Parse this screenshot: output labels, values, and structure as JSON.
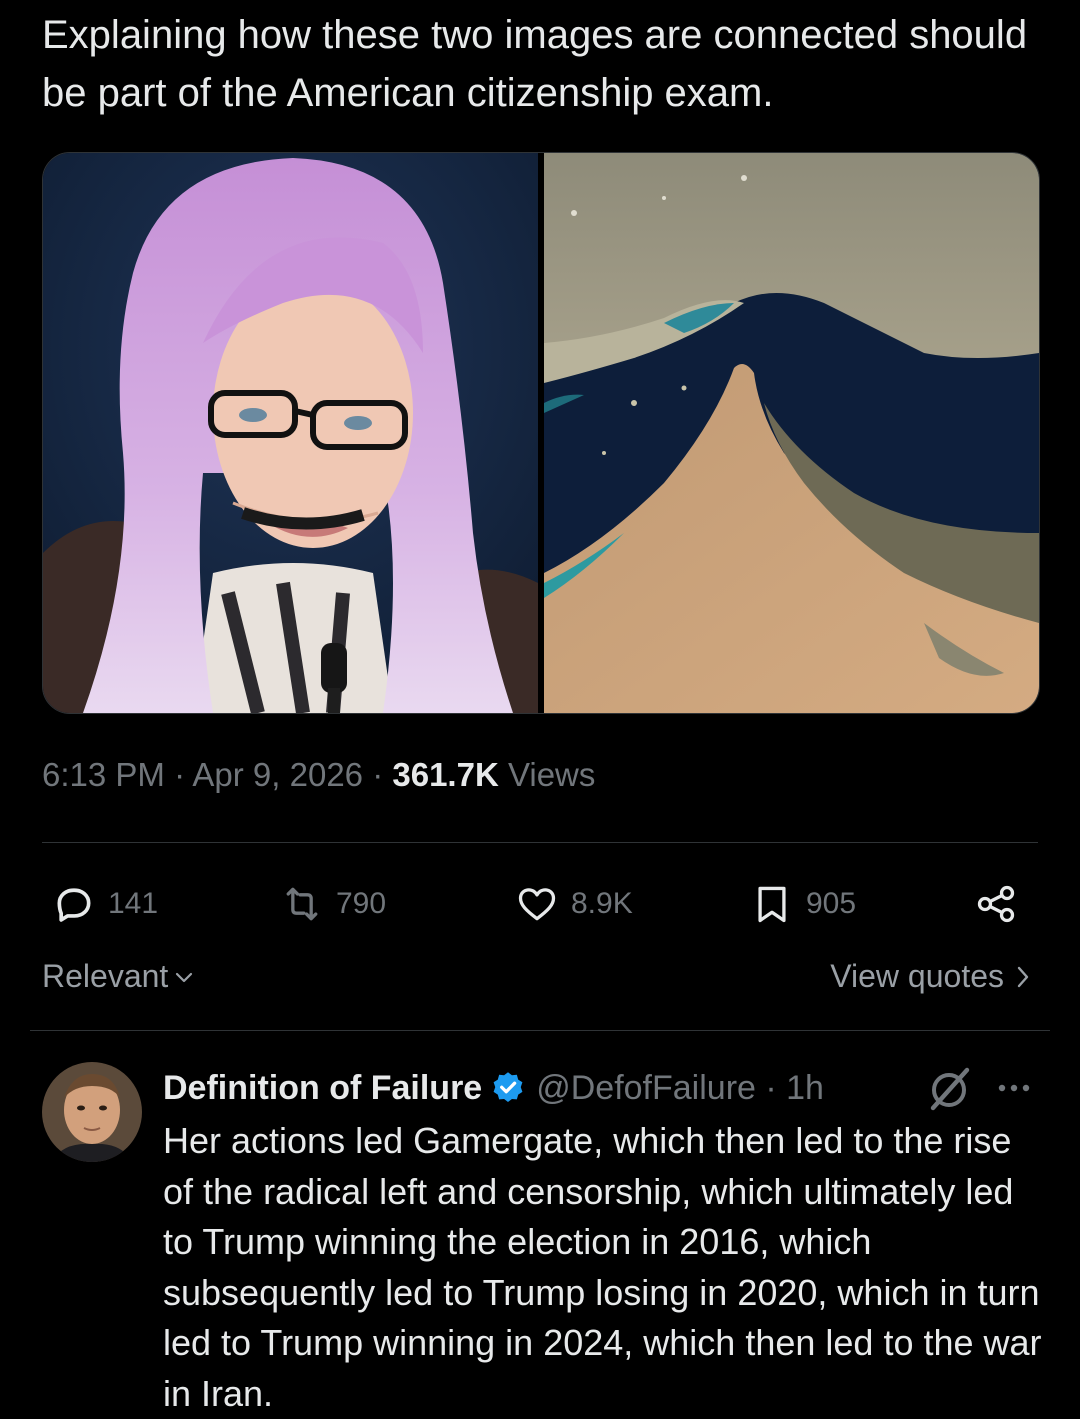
{
  "tweet": {
    "text": "Explaining how these two images are connected should be part of the American citizenship exam.",
    "time": "6:13 PM · Apr 9, 2026 · ",
    "views_count": "361.7K",
    "views_label": " Views"
  },
  "actions": {
    "replies": "141",
    "reposts": "790",
    "likes": "8.9K",
    "bookmarks": "905"
  },
  "sort": {
    "label": "Relevant",
    "view_quotes": "View quotes"
  },
  "reply": {
    "name": "Definition of Failure",
    "handle": "@DefofFailure · 1h",
    "text": "Her actions led Gamergate, which then led to the rise of the radical left and censorship, which ultimately led to Trump winning the election in 2016, which subsequently led to Trump losing in 2020, which in turn led to Trump winning in 2024, which then led to the war in Iran."
  },
  "icons": {
    "reply": "speech-bubble-icon",
    "repost": "repost-arrows-icon",
    "like": "heart-icon",
    "bookmark": "bookmark-icon",
    "share": "share-icon",
    "verified": "verified-badge-icon",
    "grok": "grok-slash-circle-icon",
    "more": "more-dots-icon"
  },
  "colors": {
    "background": "#000000",
    "text_primary": "#e7e9ea",
    "text_secondary": "#71767b",
    "verified_blue": "#1d9bf0"
  }
}
